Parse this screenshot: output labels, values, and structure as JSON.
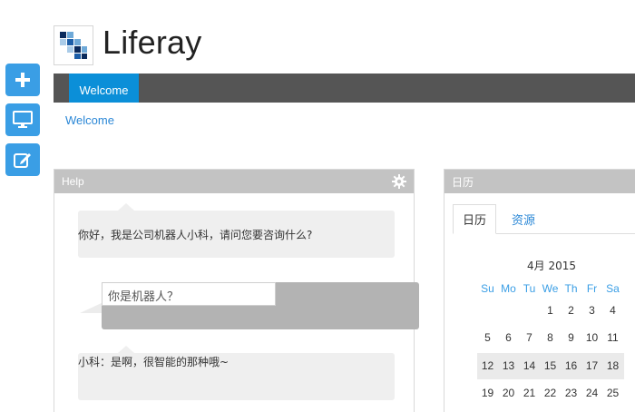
{
  "header": {
    "site_title": "Liferay"
  },
  "nav": {
    "tabs": [
      {
        "label": "Welcome",
        "active": true
      }
    ]
  },
  "breadcrumb": {
    "current": "Welcome"
  },
  "dock": {
    "icons": [
      "add-icon",
      "monitor-icon",
      "edit-icon"
    ]
  },
  "help_portlet": {
    "title": "Help",
    "messages": [
      {
        "speaker": "bot",
        "text": "你好，我是公司机器人小科，请问您要咨询什么?"
      },
      {
        "speaker": "bot",
        "text": "小科：是啊，很智能的那种哦~"
      }
    ],
    "input": {
      "value": "你是机器人？"
    }
  },
  "calendar_portlet": {
    "title": "日历",
    "tabs": [
      {
        "label": "日历",
        "active": true
      },
      {
        "label": "资源",
        "active": false
      }
    ],
    "month_label": "4月 2015",
    "weekdays": [
      "Su",
      "Mo",
      "Tu",
      "We",
      "Th",
      "Fr",
      "Sa"
    ],
    "weeks": [
      [
        "",
        "",
        "",
        "1",
        "2",
        "3",
        "4"
      ],
      [
        "5",
        "6",
        "7",
        "8",
        "9",
        "10",
        "11"
      ],
      [
        "12",
        "13",
        "14",
        "15",
        "16",
        "17",
        "18"
      ],
      [
        "19",
        "20",
        "21",
        "22",
        "23",
        "24",
        "25"
      ]
    ],
    "highlighted_week_index": 2
  },
  "colors": {
    "accent": "#0b8fd8",
    "dock": "#3a9ee5",
    "navbar": "#555555",
    "portlet_header": "#c3c3c3"
  }
}
